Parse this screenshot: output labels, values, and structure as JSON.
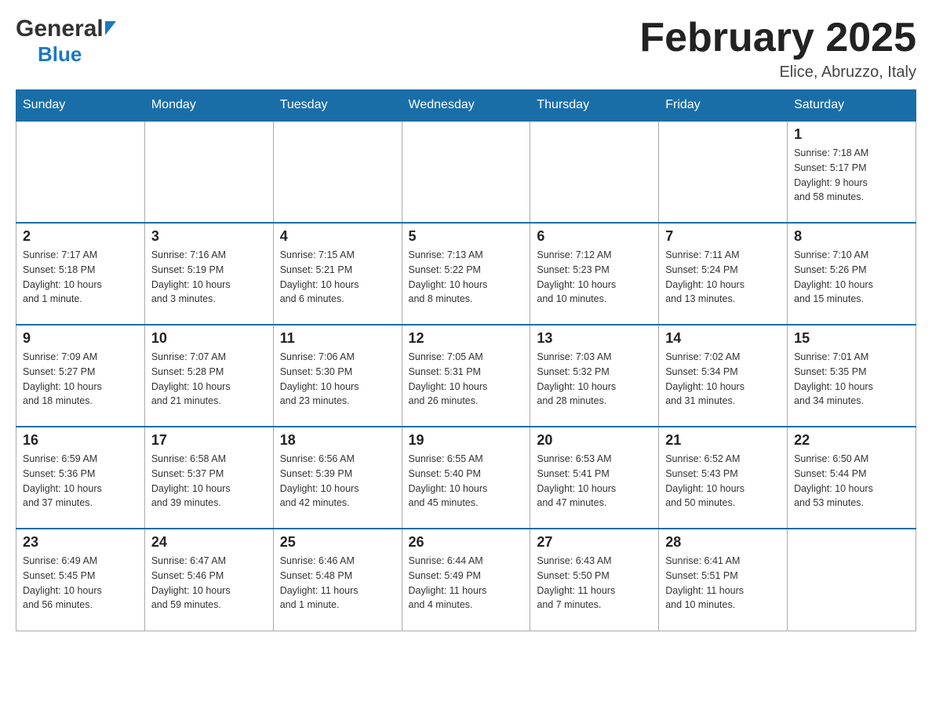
{
  "logo": {
    "general": "General",
    "blue": "Blue"
  },
  "title": "February 2025",
  "location": "Elice, Abruzzo, Italy",
  "days_header": [
    "Sunday",
    "Monday",
    "Tuesday",
    "Wednesday",
    "Thursday",
    "Friday",
    "Saturday"
  ],
  "weeks": [
    [
      {
        "day": "",
        "info": ""
      },
      {
        "day": "",
        "info": ""
      },
      {
        "day": "",
        "info": ""
      },
      {
        "day": "",
        "info": ""
      },
      {
        "day": "",
        "info": ""
      },
      {
        "day": "",
        "info": ""
      },
      {
        "day": "1",
        "info": "Sunrise: 7:18 AM\nSunset: 5:17 PM\nDaylight: 9 hours\nand 58 minutes."
      }
    ],
    [
      {
        "day": "2",
        "info": "Sunrise: 7:17 AM\nSunset: 5:18 PM\nDaylight: 10 hours\nand 1 minute."
      },
      {
        "day": "3",
        "info": "Sunrise: 7:16 AM\nSunset: 5:19 PM\nDaylight: 10 hours\nand 3 minutes."
      },
      {
        "day": "4",
        "info": "Sunrise: 7:15 AM\nSunset: 5:21 PM\nDaylight: 10 hours\nand 6 minutes."
      },
      {
        "day": "5",
        "info": "Sunrise: 7:13 AM\nSunset: 5:22 PM\nDaylight: 10 hours\nand 8 minutes."
      },
      {
        "day": "6",
        "info": "Sunrise: 7:12 AM\nSunset: 5:23 PM\nDaylight: 10 hours\nand 10 minutes."
      },
      {
        "day": "7",
        "info": "Sunrise: 7:11 AM\nSunset: 5:24 PM\nDaylight: 10 hours\nand 13 minutes."
      },
      {
        "day": "8",
        "info": "Sunrise: 7:10 AM\nSunset: 5:26 PM\nDaylight: 10 hours\nand 15 minutes."
      }
    ],
    [
      {
        "day": "9",
        "info": "Sunrise: 7:09 AM\nSunset: 5:27 PM\nDaylight: 10 hours\nand 18 minutes."
      },
      {
        "day": "10",
        "info": "Sunrise: 7:07 AM\nSunset: 5:28 PM\nDaylight: 10 hours\nand 21 minutes."
      },
      {
        "day": "11",
        "info": "Sunrise: 7:06 AM\nSunset: 5:30 PM\nDaylight: 10 hours\nand 23 minutes."
      },
      {
        "day": "12",
        "info": "Sunrise: 7:05 AM\nSunset: 5:31 PM\nDaylight: 10 hours\nand 26 minutes."
      },
      {
        "day": "13",
        "info": "Sunrise: 7:03 AM\nSunset: 5:32 PM\nDaylight: 10 hours\nand 28 minutes."
      },
      {
        "day": "14",
        "info": "Sunrise: 7:02 AM\nSunset: 5:34 PM\nDaylight: 10 hours\nand 31 minutes."
      },
      {
        "day": "15",
        "info": "Sunrise: 7:01 AM\nSunset: 5:35 PM\nDaylight: 10 hours\nand 34 minutes."
      }
    ],
    [
      {
        "day": "16",
        "info": "Sunrise: 6:59 AM\nSunset: 5:36 PM\nDaylight: 10 hours\nand 37 minutes."
      },
      {
        "day": "17",
        "info": "Sunrise: 6:58 AM\nSunset: 5:37 PM\nDaylight: 10 hours\nand 39 minutes."
      },
      {
        "day": "18",
        "info": "Sunrise: 6:56 AM\nSunset: 5:39 PM\nDaylight: 10 hours\nand 42 minutes."
      },
      {
        "day": "19",
        "info": "Sunrise: 6:55 AM\nSunset: 5:40 PM\nDaylight: 10 hours\nand 45 minutes."
      },
      {
        "day": "20",
        "info": "Sunrise: 6:53 AM\nSunset: 5:41 PM\nDaylight: 10 hours\nand 47 minutes."
      },
      {
        "day": "21",
        "info": "Sunrise: 6:52 AM\nSunset: 5:43 PM\nDaylight: 10 hours\nand 50 minutes."
      },
      {
        "day": "22",
        "info": "Sunrise: 6:50 AM\nSunset: 5:44 PM\nDaylight: 10 hours\nand 53 minutes."
      }
    ],
    [
      {
        "day": "23",
        "info": "Sunrise: 6:49 AM\nSunset: 5:45 PM\nDaylight: 10 hours\nand 56 minutes."
      },
      {
        "day": "24",
        "info": "Sunrise: 6:47 AM\nSunset: 5:46 PM\nDaylight: 10 hours\nand 59 minutes."
      },
      {
        "day": "25",
        "info": "Sunrise: 6:46 AM\nSunset: 5:48 PM\nDaylight: 11 hours\nand 1 minute."
      },
      {
        "day": "26",
        "info": "Sunrise: 6:44 AM\nSunset: 5:49 PM\nDaylight: 11 hours\nand 4 minutes."
      },
      {
        "day": "27",
        "info": "Sunrise: 6:43 AM\nSunset: 5:50 PM\nDaylight: 11 hours\nand 7 minutes."
      },
      {
        "day": "28",
        "info": "Sunrise: 6:41 AM\nSunset: 5:51 PM\nDaylight: 11 hours\nand 10 minutes."
      },
      {
        "day": "",
        "info": ""
      }
    ]
  ]
}
